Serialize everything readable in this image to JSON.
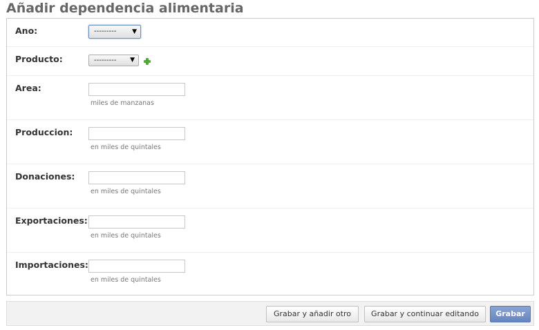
{
  "title": "Añadir dependencia alimentaria",
  "fields": {
    "ano": {
      "label": "Ano:",
      "value": "---------"
    },
    "producto": {
      "label": "Producto:",
      "value": "---------"
    },
    "area": {
      "label": "Area:",
      "value": "",
      "help": "miles de manzanas"
    },
    "produccion": {
      "label": "Produccion:",
      "value": "",
      "help": "en miles de quintales"
    },
    "donaciones": {
      "label": "Donaciones:",
      "value": "",
      "help": "en miles de quintales"
    },
    "exportaciones": {
      "label": "Exportaciones:",
      "value": "",
      "help": "en miles de quintales"
    },
    "importaciones": {
      "label": "Importaciones:",
      "value": "",
      "help": "en miles de quintales"
    }
  },
  "buttons": {
    "save_add_another": "Grabar y añadir otro",
    "save_continue": "Grabar y continuar editando",
    "save": "Grabar"
  },
  "icons": {
    "dropdown": "chevron-down-icon",
    "add_related": "plus-icon"
  },
  "colors": {
    "add_icon": "#4caf2a",
    "primary_button": "#6f8fc6",
    "title": "#666666"
  }
}
